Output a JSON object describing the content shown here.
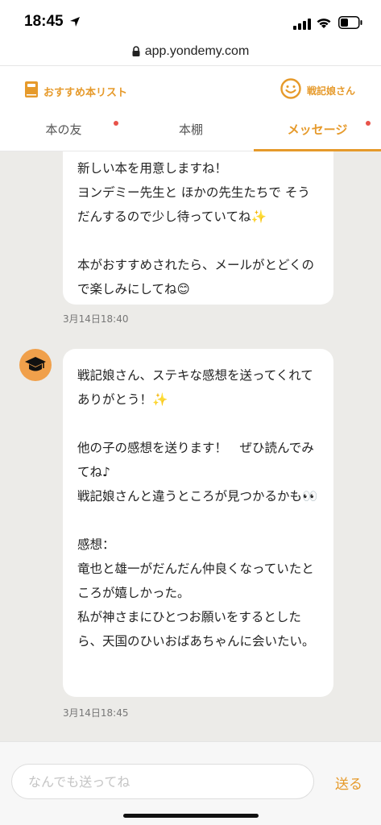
{
  "status_bar": {
    "time": "18:45"
  },
  "url_bar": {
    "url": "app.yondemy.com"
  },
  "header": {
    "recommend_label": "おすすめ本リスト",
    "user_label": "戦記娘さん"
  },
  "tabs": [
    {
      "label": "本の友",
      "has_dot": true
    },
    {
      "label": "本棚",
      "has_dot": false
    },
    {
      "label": "メッセージ",
      "has_dot": true,
      "active": true
    }
  ],
  "messages": [
    {
      "text": "新しい本を用意しますね！\nヨンデミー先生と ほかの先生たちで そうだんするので少し待っていてね✨\n\n本がおすすめされたら、メールがとどくので楽しみにしてね😊",
      "timestamp": "3月14日18:40"
    },
    {
      "text": "戦記娘さん、ステキな感想を送ってくれてありがとう！✨\n\n他の子の感想を送ります！　ぜひ読んでみてね♪\n戦記娘さんと違うところが見つかるかも👀\n\n感想：\n竜也と雄一がだんだん仲良くなっていたところが嬉しかった。\n私が神さまにひとつお願いをするとしたら、天国のひいおばあちゃんに会いたい。",
      "timestamp": "3月14日18:45"
    }
  ],
  "composer": {
    "placeholder": "なんでも送ってね",
    "send_label": "送る"
  },
  "colors": {
    "accent": "#e69a2b",
    "chat_bg": "#ecebe8",
    "dot": "#e8534a"
  }
}
